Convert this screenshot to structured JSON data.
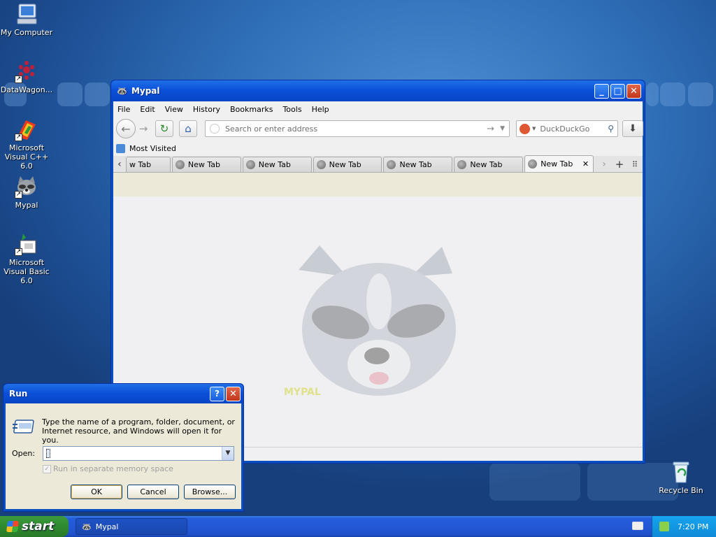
{
  "desktop": {
    "icons": [
      {
        "label": "My Computer",
        "icon": "my-computer-icon"
      },
      {
        "label": "DataWagon...",
        "icon": "datawagon-icon"
      },
      {
        "label": "Microsoft Visual C++ 6.0",
        "icon": "visual-cpp-icon"
      },
      {
        "label": "Mypal",
        "icon": "mypal-raccoon-icon"
      },
      {
        "label": "Microsoft Visual Basic 6.0",
        "icon": "visual-basic-icon"
      },
      {
        "label": "Recycle Bin",
        "icon": "recycle-bin-icon"
      }
    ]
  },
  "browser": {
    "title": "Mypal",
    "menu": [
      "File",
      "Edit",
      "View",
      "History",
      "Bookmarks",
      "Tools",
      "Help"
    ],
    "url_placeholder": "Search or enter address",
    "search_engine": "DuckDuckGo",
    "bookmark": "Most Visited",
    "tabs": [
      "w Tab",
      "New Tab",
      "New Tab",
      "New Tab",
      "New Tab",
      "New Tab",
      "New Tab"
    ],
    "selected_tab_index": 6,
    "logo_text": "MYPAL"
  },
  "run_dialog": {
    "title": "Run",
    "description": "Type the name of a program, folder, document, or Internet resource, and Windows will open it for you.",
    "open_label": "Open:",
    "open_value": "",
    "checkbox_label": "Run in separate memory space",
    "ok": "OK",
    "cancel": "Cancel",
    "browse": "Browse..."
  },
  "taskbar": {
    "start": "start",
    "items": [
      "Mypal"
    ],
    "clock": "7:20 PM"
  },
  "colors": {
    "titlebar": "#0a4fd8",
    "taskbar": "#245edb",
    "start": "#2f8a2f",
    "tray": "#0f8ad6"
  }
}
